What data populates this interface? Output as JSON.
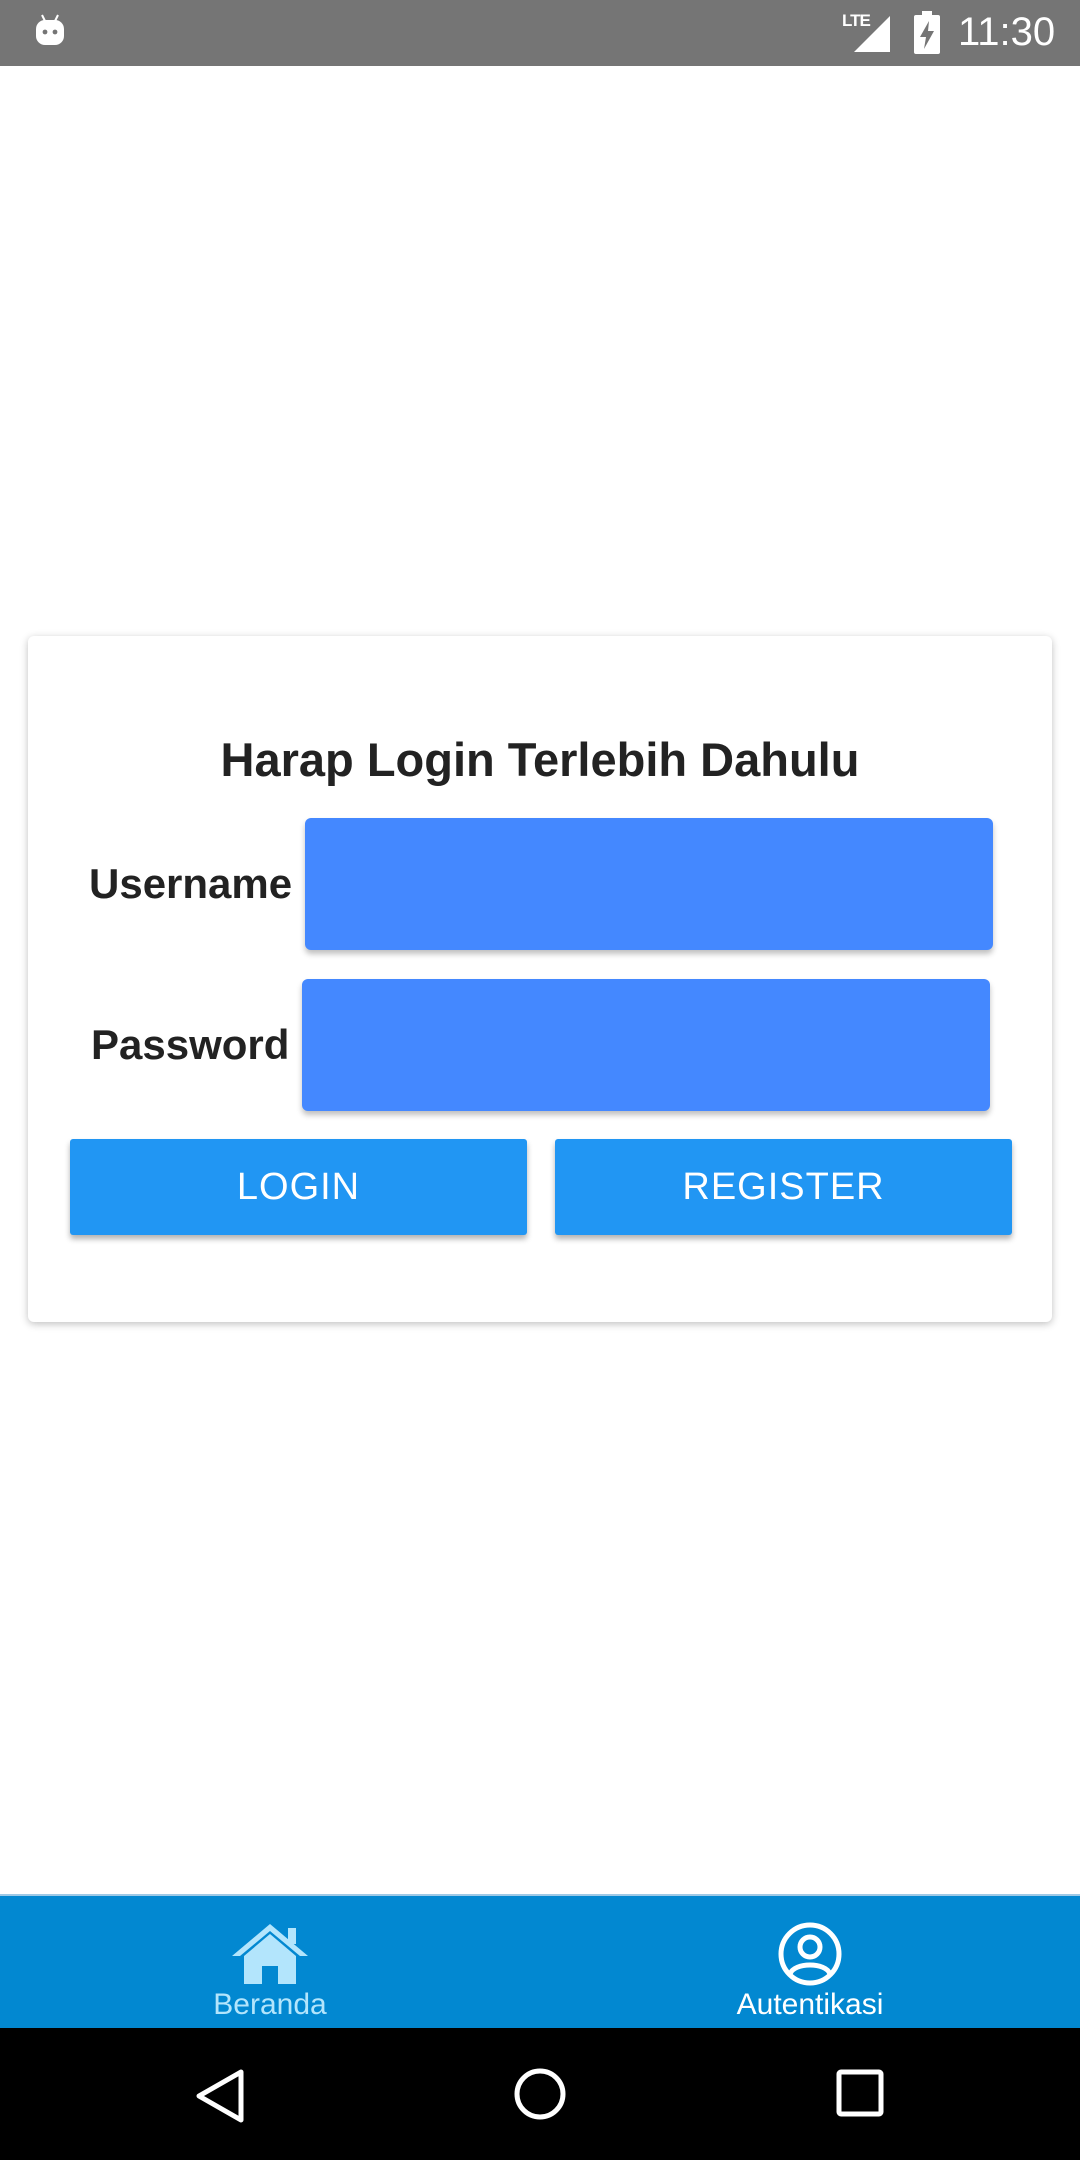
{
  "status_bar": {
    "network": "LTE",
    "time": "11:30"
  },
  "login": {
    "title": "Harap Login Terlebih Dahulu",
    "username_label": "Username",
    "username_value": "",
    "password_label": "Password",
    "password_value": "",
    "login_button": "LOGIN",
    "register_button": "REGISTER"
  },
  "tabs": [
    {
      "label": "Beranda",
      "icon": "home-icon"
    },
    {
      "label": "Autentikasi",
      "icon": "user-circle-icon"
    }
  ],
  "colors": {
    "status_bar": "#757575",
    "input_bg": "#4488FF",
    "button_bg": "#2196F3",
    "tab_bar": "#0288D1",
    "tab_inactive": "#B3E5FC",
    "tab_active": "#FFFFFF"
  }
}
